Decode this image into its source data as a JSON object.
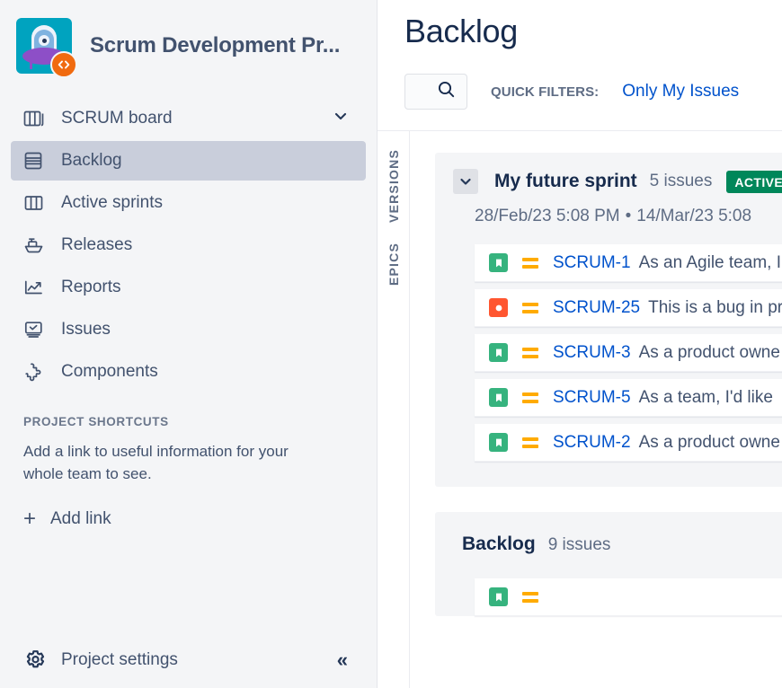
{
  "sidebar": {
    "project": {
      "title": "Scrum Development Pr...",
      "avatar_icon": "ufo-project-avatar",
      "badge_icon": "code-badge-icon",
      "avatar_bg": "#00A3BF",
      "badge_bg": "#F06A0F"
    },
    "nav": [
      {
        "label": "SCRUM board",
        "icon": "board-icon",
        "selected": false,
        "trailing_icon": "chevron-down-icon"
      },
      {
        "label": "Backlog",
        "icon": "backlog-icon",
        "selected": true,
        "trailing_icon": ""
      },
      {
        "label": "Active sprints",
        "icon": "columns-icon",
        "selected": false,
        "trailing_icon": ""
      },
      {
        "label": "Releases",
        "icon": "ship-icon",
        "selected": false,
        "trailing_icon": ""
      },
      {
        "label": "Reports",
        "icon": "chart-line-icon",
        "selected": false,
        "trailing_icon": ""
      },
      {
        "label": "Issues",
        "icon": "issues-icon",
        "selected": false,
        "trailing_icon": ""
      },
      {
        "label": "Components",
        "icon": "puzzle-icon",
        "selected": false,
        "trailing_icon": ""
      }
    ],
    "shortcuts": {
      "heading": "PROJECT SHORTCUTS",
      "description": "Add a link to useful information for your whole team to see.",
      "add_link_label": "Add link",
      "add_icon": "plus-icon"
    },
    "footer": {
      "settings_label": "Project settings",
      "settings_icon": "gear-icon",
      "collapse_icon": "double-chevron-left-icon",
      "collapse_glyph": "«"
    }
  },
  "main": {
    "page_title": "Backlog",
    "search": {
      "placeholder": "",
      "value": "",
      "icon": "search-icon"
    },
    "quick_filters_label": "QUICK FILTERS:",
    "quick_filters": [
      "Only My Issues"
    ],
    "side_tabs": [
      "VERSIONS",
      "EPICS"
    ],
    "sprint": {
      "collapse_icon": "chevron-down-icon",
      "name": "My future sprint",
      "issue_count": "5 issues",
      "status_badge": "ACTIVE",
      "badge_color": "#00875A",
      "start_date": "28/Feb/23 5:08 PM",
      "separator": "•",
      "end_date": "14/Mar/23 5:08",
      "issues": [
        {
          "type": "story",
          "type_icon": "story-bookmark-icon",
          "priority": "medium",
          "priority_icon": "priority-medium-icon",
          "key": "SCRUM-1",
          "summary": "As an Agile team, I"
        },
        {
          "type": "bug",
          "type_icon": "bug-circle-icon",
          "priority": "medium",
          "priority_icon": "priority-medium-icon",
          "key": "SCRUM-25",
          "summary": "This is a bug in pr"
        },
        {
          "type": "story",
          "type_icon": "story-bookmark-icon",
          "priority": "medium",
          "priority_icon": "priority-medium-icon",
          "key": "SCRUM-3",
          "summary": "As a product owne"
        },
        {
          "type": "story",
          "type_icon": "story-bookmark-icon",
          "priority": "medium",
          "priority_icon": "priority-medium-icon",
          "key": "SCRUM-5",
          "summary": "As a team, I'd like"
        },
        {
          "type": "story",
          "type_icon": "story-bookmark-icon",
          "priority": "medium",
          "priority_icon": "priority-medium-icon",
          "key": "SCRUM-2",
          "summary": "As a product owne"
        }
      ]
    },
    "backlog": {
      "name": "Backlog",
      "issue_count": "9 issues"
    }
  }
}
